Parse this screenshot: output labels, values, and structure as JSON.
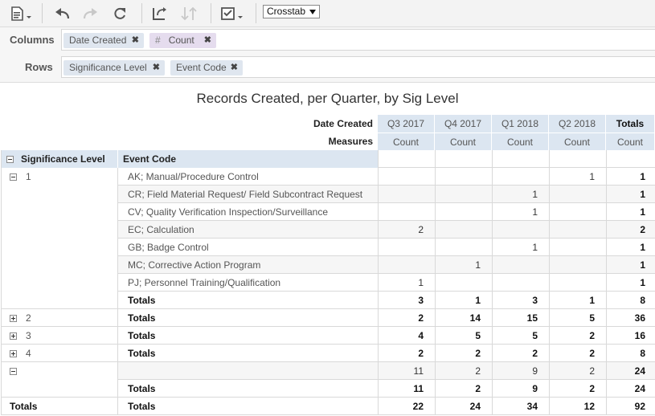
{
  "toolbar": {
    "view_select": "Crosstab",
    "icons": [
      "export-icon",
      "undo-icon",
      "redo-icon",
      "reset-icon",
      "switch-axes-icon",
      "sort-icon",
      "options-icon"
    ]
  },
  "columns_shelf": {
    "label": "Columns",
    "pills": [
      {
        "label": "Date Created",
        "kind": "dimension"
      },
      {
        "label": "Count",
        "kind": "measure",
        "prefix": "#"
      }
    ]
  },
  "rows_shelf": {
    "label": "Rows",
    "pills": [
      {
        "label": "Significance Level",
        "kind": "dimension"
      },
      {
        "label": "Event Code",
        "kind": "dimension"
      }
    ]
  },
  "report": {
    "title": "Records Created, per Quarter, by Sig Level",
    "col_header_label": "Date Created",
    "measures_label": "Measures",
    "quarters": [
      "Q3 2017",
      "Q4 2017",
      "Q1 2018",
      "Q2 2018",
      "Totals"
    ],
    "measure_names": [
      "Count",
      "Count",
      "Count",
      "Count",
      "Count"
    ],
    "row_headers": [
      "Significance Level",
      "Event Code"
    ],
    "rows": [
      {
        "level": "1",
        "toggle": "minus",
        "code": "AK; Manual/Procedure Control",
        "values": [
          "",
          "",
          "",
          "1",
          "1"
        ]
      },
      {
        "code": "CR; Field Material Request/ Field Subcontract Request",
        "values": [
          "",
          "",
          "1",
          "",
          "1"
        ]
      },
      {
        "code": "CV; Quality Verification Inspection/Surveillance",
        "values": [
          "",
          "",
          "1",
          "",
          "1"
        ]
      },
      {
        "code": "EC; Calculation",
        "values": [
          "2",
          "",
          "",
          "",
          "2"
        ]
      },
      {
        "code": "GB; Badge Control",
        "values": [
          "",
          "",
          "1",
          "",
          "1"
        ]
      },
      {
        "code": "MC; Corrective Action Program",
        "values": [
          "",
          "1",
          "",
          "",
          "1"
        ]
      },
      {
        "code": "PJ; Personnel Training/Qualification",
        "values": [
          "1",
          "",
          "",
          "",
          "1"
        ]
      },
      {
        "code": "Totals",
        "total": true,
        "values": [
          "3",
          "1",
          "3",
          "1",
          "8"
        ]
      },
      {
        "level": "2",
        "toggle": "plus",
        "code": "Totals",
        "total": true,
        "values": [
          "2",
          "14",
          "15",
          "5",
          "36"
        ]
      },
      {
        "level": "3",
        "toggle": "plus",
        "code": "Totals",
        "total": true,
        "values": [
          "4",
          "5",
          "5",
          "2",
          "16"
        ]
      },
      {
        "level": "4",
        "toggle": "plus",
        "code": "Totals",
        "total": true,
        "values": [
          "2",
          "2",
          "2",
          "2",
          "8"
        ]
      },
      {
        "level": "",
        "toggle": "minus",
        "code": "",
        "values": [
          "11",
          "2",
          "9",
          "2",
          "24"
        ]
      },
      {
        "code": "Totals",
        "total": true,
        "values": [
          "11",
          "2",
          "9",
          "2",
          "24"
        ]
      },
      {
        "level": "Totals",
        "grand": true,
        "code": "Totals",
        "total": true,
        "values": [
          "22",
          "24",
          "34",
          "12",
          "92"
        ]
      }
    ]
  }
}
